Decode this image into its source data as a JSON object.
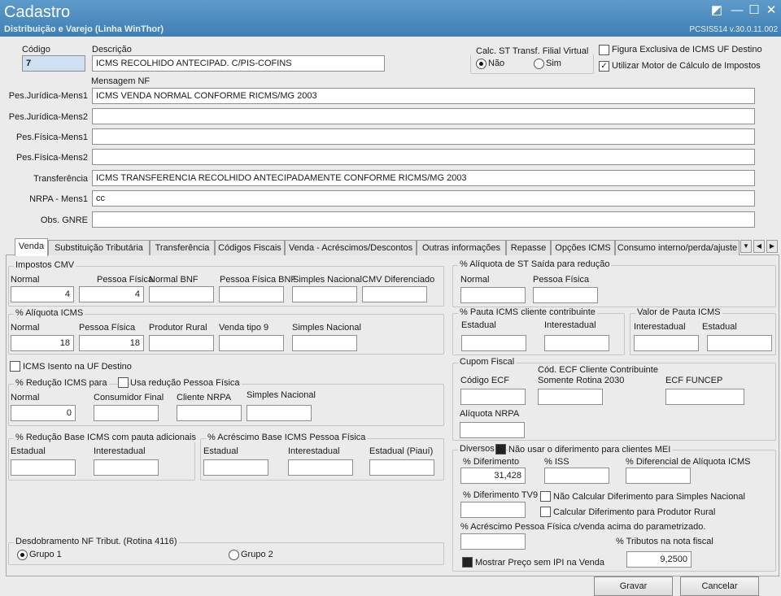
{
  "window": {
    "title": "Cadastro",
    "subtitle": "Distribuição e Varejo (Linha WinThor)",
    "version": "PCSIS514  v.30.0.11.002"
  },
  "header": {
    "codigo_label": "Código",
    "codigo_value": "7",
    "descricao_label": "Descrição",
    "descricao_value": "ICMS RECOLHIDO ANTECIPAD. C/PIS-COFINS",
    "calc_st_label": "Calc. ST Transf. Filial Virtual",
    "calc_st_nao": "Não",
    "calc_st_sim": "Sim",
    "calc_st_selected": "Não",
    "figura_label": "Figura Exclusiva de ICMS UF Destino",
    "figura_checked": false,
    "motor_label": "Utilizar Motor de Cálculo de Impostos",
    "motor_checked": true,
    "mensagem_label": "Mensagem NF"
  },
  "messages": [
    {
      "label": "Pes.Jurídica-Mens1",
      "value": "ICMS  VENDA NORMAL  CONFORME RICMS/MG 2003"
    },
    {
      "label": "Pes.Jurídica-Mens2",
      "value": ""
    },
    {
      "label": "Pes.Física-Mens1",
      "value": ""
    },
    {
      "label": "Pes.Física-Mens2",
      "value": ""
    },
    {
      "label": "Transferência",
      "value": "ICMS  TRANSFERENCIA  RECOLHIDO ANTECIPADAMENTE CONFORME RICMS/MG 2003"
    },
    {
      "label": "NRPA - Mens1",
      "value": "cc"
    },
    {
      "label": "Obs. GNRE",
      "value": ""
    }
  ],
  "tabs": [
    "Venda",
    "Substituição Tributária",
    "Transferência",
    "Códigos Fiscais",
    "Venda - Acréscimos/Descontos",
    "Outras informações",
    "Repasse",
    "Opções ICMS",
    "Consumo interno/perda/ajuste"
  ],
  "venda": {
    "impostos_cmv": {
      "title": "Impostos CMV",
      "normal": "Normal",
      "normal_value": "4",
      "pf": "Pessoa Física",
      "pf_value": "4",
      "bnf": "Normal BNF",
      "pf_bnf": "Pessoa Física BNF",
      "simples": "Simples Nacional",
      "cmv_dif": "CMV Diferenciado"
    },
    "aliquota_icms": {
      "title": "% Alíquota ICMS",
      "normal": "Normal",
      "normal_value": "18",
      "pf": "Pessoa Física",
      "pf_value": "18",
      "prod_rural": "Produtor Rural",
      "venda_tipo9": "Venda tipo 9",
      "simples": "Simples Nacional"
    },
    "icms_isento_label": "ICMS Isento na UF Destino",
    "reducao": {
      "title": "% Redução ICMS para",
      "usa_pf": "Usa redução Pessoa Física",
      "normal": "Normal",
      "normal_value": "0",
      "consumidor": "Consumidor Final",
      "nrpa": "Cliente NRPA",
      "simples": "Simples Nacional"
    },
    "reducao_base": {
      "title": "% Redução Base ICMS com pauta adicionais",
      "estadual": "Estadual",
      "interestadual": "Interestadual"
    },
    "acrescimo_base": {
      "title": "% Acréscimo Base ICMS Pessoa Física",
      "estadual": "Estadual",
      "interestadual": "Interestadual",
      "piaui": "Estadual (Piauí)"
    },
    "desdobramento": {
      "title": "Desdobramento NF Tribut. (Rotina 4116)",
      "grupo1": "Grupo 1",
      "grupo2": "Grupo 2",
      "selected": "Grupo 1"
    },
    "aliq_st_saida": {
      "title": "% Alíquota de ST Saída para redução",
      "normal": "Normal",
      "pf": "Pessoa Física"
    },
    "pauta_contrib": {
      "title": "% Pauta ICMS cliente contribuinte",
      "estadual": "Estadual",
      "interestadual": "Interestadual"
    },
    "valor_pauta": {
      "title": "Valor de Pauta ICMS",
      "interestadual": "Interestadual",
      "estadual": "Estadual"
    },
    "cupom": {
      "title": "Cupom Fiscal",
      "codigo_ecf": "Código ECF",
      "cod_ecf_contrib_1": "Cód. ECF Cliente Contribuinte",
      "cod_ecf_contrib_2": "Somente Rotina 2030",
      "ecf_funcep": "ECF FUNCEP",
      "aliq_nrpa": "Alíquota NRPA"
    },
    "diversos": {
      "title": "Diversos",
      "nao_usar_mei": "Não usar o diferimento para clientes MEI",
      "diferimento": "% Diferimento",
      "diferimento_value": "31,428",
      "iss": "% ISS",
      "dif_aliquota": "% Diferencial de Alíquota ICMS",
      "diferimento_tv9": "% Diferimento TV9",
      "nao_calc_simples": "Não Calcular Diferimento para Simples Nacional",
      "calc_prod_rural": "Calcular Diferimento para Produtor Rural",
      "acrescimo_pf": "% Acréscimo Pessoa Física c/venda acima do parametrizado.",
      "tributos": "% Tributos na nota fiscal",
      "tributos_value": "9,2500",
      "mostrar_preco": "Mostrar Preço sem IPI na Venda"
    }
  },
  "buttons": {
    "gravar": "Gravar",
    "cancelar": "Cancelar"
  }
}
